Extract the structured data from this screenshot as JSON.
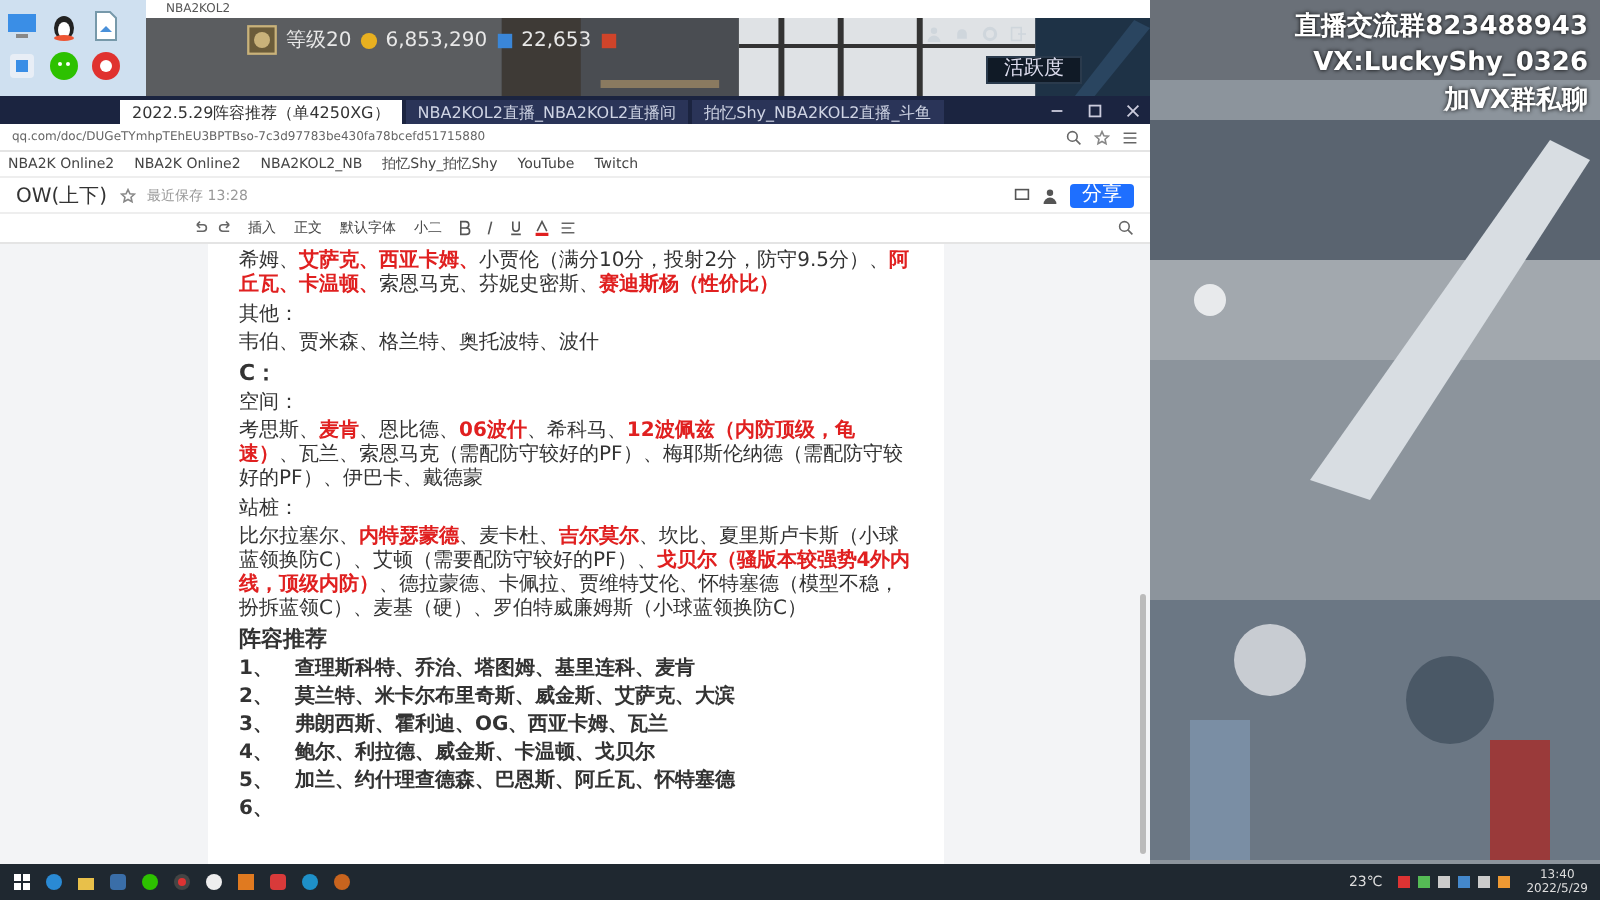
{
  "game": {
    "title": "NBA2KOL2",
    "rank_label": "等级20",
    "coins": "6,853,290",
    "points": "22,653",
    "activity_button": "活跃度"
  },
  "stream_overlay": {
    "lines": [
      "直播交流群823488943",
      "VX:LuckyShy_0326",
      "加VX群私聊"
    ]
  },
  "browser": {
    "tabs": [
      {
        "label": "2022.5.29阵容推荐（单4250XG）",
        "selected": true
      },
      {
        "label": "NBA2KOL2直播_NBA2KOL2直播间",
        "selected": false
      },
      {
        "label": "拍忆Shy_NBA2KOL2直播_斗鱼",
        "selected": false
      }
    ],
    "address": "qq.com/doc/DUGeTYmhpTEhEU3BPTBso-7c3d97783be430fa78bcefd51715880",
    "bookmarks": [
      "NBA2K Online2",
      "NBA2K Online2",
      "NBA2KOL2_NB",
      "拍忆Shy_拍忆Shy",
      "YouTube",
      "Twitch"
    ]
  },
  "document": {
    "title": "OW(上下)",
    "save_status": "最近保存 13:28",
    "share_button": "分享",
    "toolbar": [
      "插入",
      "正文",
      "默认字体",
      "小二"
    ],
    "blocks": [
      {
        "kind": "paragraph",
        "segments": [
          {
            "text": "希姆、",
            "highlight": false
          },
          {
            "text": "艾萨克、西亚卡姆、",
            "highlight": true
          },
          {
            "text": "小贾伦（满分10分，投射2分，防守9.5分）、",
            "highlight": false
          },
          {
            "text": "阿丘瓦、卡温顿、",
            "highlight": true
          },
          {
            "text": "索恩马克、芬妮史密斯、",
            "highlight": false
          },
          {
            "text": "赛迪斯杨（性价比）",
            "highlight": true
          }
        ]
      },
      {
        "kind": "label",
        "segments": [
          {
            "text": "其他：",
            "highlight": false
          }
        ]
      },
      {
        "kind": "paragraph",
        "segments": [
          {
            "text": "韦伯、贾米森、格兰特、奥托波特、波什",
            "highlight": false
          }
        ]
      },
      {
        "kind": "heading",
        "segments": [
          {
            "text": "C：",
            "highlight": false
          }
        ]
      },
      {
        "kind": "label",
        "segments": [
          {
            "text": "空间：",
            "highlight": false
          }
        ]
      },
      {
        "kind": "paragraph",
        "segments": [
          {
            "text": "考思斯、",
            "highlight": false
          },
          {
            "text": "麦肯",
            "highlight": true
          },
          {
            "text": "、恩比德、",
            "highlight": false
          },
          {
            "text": "06波什",
            "highlight": true
          },
          {
            "text": "、希科马、",
            "highlight": false
          },
          {
            "text": "12波佩兹（内防顶级，龟速）",
            "highlight": true
          },
          {
            "text": "、瓦兰、索恩马克（需配防守较好的PF）、梅耶斯伦纳德（需配防守较好的PF）、伊巴卡、戴德蒙",
            "highlight": false
          }
        ]
      },
      {
        "kind": "label",
        "segments": [
          {
            "text": "站桩：",
            "highlight": false
          }
        ]
      },
      {
        "kind": "paragraph",
        "segments": [
          {
            "text": "比尔拉塞尔、",
            "highlight": false
          },
          {
            "text": "内特瑟蒙德",
            "highlight": true
          },
          {
            "text": "、麦卡杜、",
            "highlight": false
          },
          {
            "text": "吉尔莫尔",
            "highlight": true
          },
          {
            "text": "、坎比、夏里斯卢卡斯（小球蓝领换防C）、艾顿（需要配防守较好的PF）、",
            "highlight": false
          },
          {
            "text": "戈贝尔（骚版本较强势4外内线，顶级内防）",
            "highlight": true
          },
          {
            "text": "、德拉蒙德、卡佩拉、贾维特艾伦、怀特塞德（模型不稳，扮拆蓝领C）、麦基（硬）、罗伯特威廉姆斯（小球蓝领换防C）",
            "highlight": false
          }
        ]
      },
      {
        "kind": "heading",
        "segments": [
          {
            "text": "阵容推荐",
            "highlight": false
          }
        ]
      },
      {
        "kind": "list_item",
        "number": "1、",
        "segments": [
          {
            "text": "查理斯科特、乔治、塔图姆、基里连科、麦肯",
            "highlight": false
          }
        ]
      },
      {
        "kind": "list_item",
        "number": "2、",
        "segments": [
          {
            "text": "莫兰特、米卡尔布里奇斯、威金斯、艾萨克、大滨",
            "highlight": false
          }
        ]
      },
      {
        "kind": "list_item",
        "number": "3、",
        "segments": [
          {
            "text": "弗朗西斯、霍利迪、OG、西亚卡姆、瓦兰",
            "highlight": false
          }
        ]
      },
      {
        "kind": "list_item",
        "number": "4、",
        "segments": [
          {
            "text": "鲍尔、利拉德、威金斯、卡温顿、戈贝尔",
            "highlight": false
          }
        ]
      },
      {
        "kind": "list_item",
        "number": "5、",
        "segments": [
          {
            "text": "加兰、约什理查德森、巴恩斯、阿丘瓦、怀特塞德",
            "highlight": false
          }
        ]
      },
      {
        "kind": "list_item",
        "number": "6、"
      }
    ]
  },
  "taskbar": {
    "weather": "23℃",
    "time": "13:40",
    "date": "2022/5/29"
  }
}
